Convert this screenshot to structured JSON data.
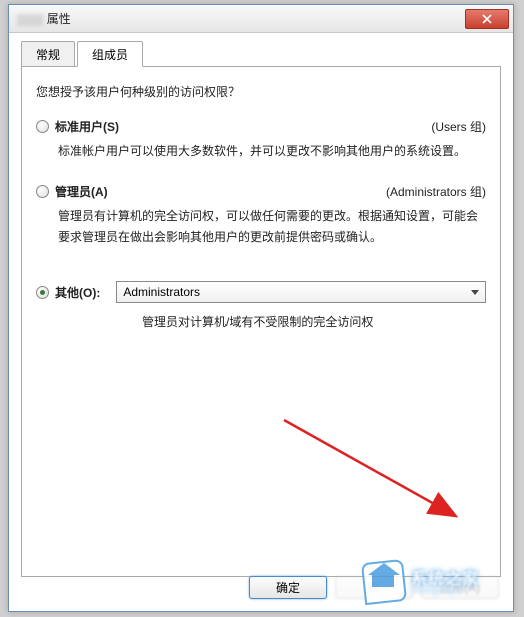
{
  "window": {
    "title_suffix": "属性"
  },
  "tabs": {
    "general": "常规",
    "members": "组成员"
  },
  "panel": {
    "question": "您想授予该用户何种级别的访问权限？",
    "standard": {
      "label": "标准用户(S)",
      "group": "(Users 组)",
      "desc": "标准帐户用户可以使用大多数软件，并可以更改不影响其他用户的系统设置。"
    },
    "admin": {
      "label": "管理员(A)",
      "group": "(Administrators 组)",
      "desc": "管理员有计算机的完全访问权，可以做任何需要的更改。根据通知设置，可能会要求管理员在做出会影响其他用户的更改前提供密码或确认。"
    },
    "other": {
      "label": "其他(O):",
      "selected": "Administrators",
      "desc": "管理员对计算机/域有不受限制的完全访问权"
    }
  },
  "buttons": {
    "ok": "确定",
    "cancel": "取消",
    "apply": "应用(A)"
  }
}
